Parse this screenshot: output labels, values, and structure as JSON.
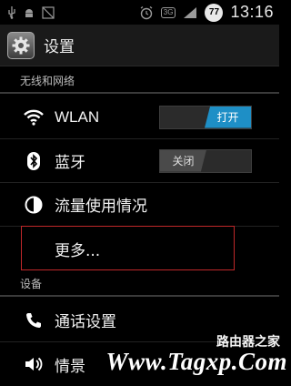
{
  "status_bar": {
    "time": "13:16",
    "battery_level": "77",
    "network_type": "3G",
    "icons": [
      "usb-icon",
      "android-debug-icon",
      "screenshot-icon",
      "alarm-icon",
      "network-3g-icon",
      "signal-icon",
      "battery-icon"
    ]
  },
  "action_bar": {
    "title": "设置",
    "icon": "settings-gear-icon"
  },
  "sections": {
    "wireless": {
      "header": "无线和网络"
    },
    "device": {
      "header": "设备"
    }
  },
  "items": {
    "wlan": {
      "label": "WLAN",
      "icon": "wifi-icon",
      "toggle_state": "on",
      "toggle_text": "打开"
    },
    "bluetooth": {
      "label": "蓝牙",
      "icon": "bluetooth-icon",
      "toggle_state": "off",
      "toggle_text": "关闭"
    },
    "data_usage": {
      "label": "流量使用情况",
      "icon": "data-usage-icon"
    },
    "more": {
      "label": "更多..."
    },
    "call_settings": {
      "label": "通话设置",
      "icon": "phone-icon"
    },
    "sound": {
      "label": "情景",
      "icon": "speaker-icon"
    }
  },
  "colors": {
    "accent": "#1e8fc6",
    "highlight_box": "#c0282a",
    "background": "#000000"
  },
  "watermark": {
    "text": "Www.Tagxp.Com",
    "subtext": "路由器之家"
  }
}
